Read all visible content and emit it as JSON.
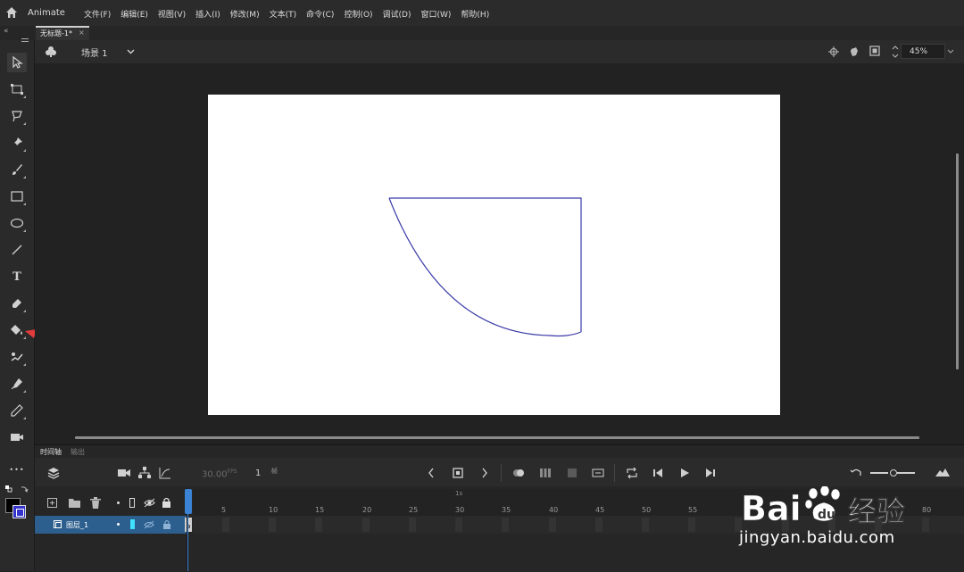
{
  "app": {
    "name": "Animate"
  },
  "menu": [
    "文件(F)",
    "编辑(E)",
    "视图(V)",
    "插入(I)",
    "修改(M)",
    "文本(T)",
    "命令(C)",
    "控制(O)",
    "调试(D)",
    "窗口(W)",
    "帮助(H)"
  ],
  "document_tab": {
    "title": "无标题-1*",
    "close": "×"
  },
  "scene_bar": {
    "scene": "场景 1",
    "zoom": "45%"
  },
  "tools": [
    {
      "name": "selection-tool-icon",
      "selected": true
    },
    {
      "name": "free-transform-tool-icon"
    },
    {
      "name": "lasso-tool-icon"
    },
    {
      "name": "pin-tool-icon"
    },
    {
      "name": "paint-brush-tool-icon"
    },
    {
      "name": "rectangle-tool-icon"
    },
    {
      "name": "oval-tool-icon"
    },
    {
      "name": "line-tool-icon"
    },
    {
      "name": "text-tool-icon",
      "glyph": "T"
    },
    {
      "name": "eraser-tool-icon"
    },
    {
      "name": "paint-bucket-tool-icon"
    },
    {
      "name": "bone-tool-icon"
    },
    {
      "name": "pen-tool-icon"
    },
    {
      "name": "eyedropper-tool-icon"
    },
    {
      "name": "camera-tool-icon"
    },
    {
      "name": "more-tools-icon",
      "glyph": "•••"
    }
  ],
  "colors": {
    "stroke": "#000000",
    "fill": "#3333cc",
    "shape_stroke": "#3a3aa8",
    "annotation_arrow": "#e23b3b",
    "playhead": "#3b83d4",
    "layer_highlight": "#2d5f8e"
  },
  "timeline": {
    "tabs": [
      "时间轴",
      "输出"
    ],
    "fps": "30.00",
    "fps_unit": "FPS",
    "current_frame": "1",
    "frame_unit": "帧",
    "ruler_numbers": [
      "5",
      "10",
      "15",
      "20",
      "25",
      "30",
      "35",
      "40",
      "45",
      "50",
      "55",
      "80"
    ],
    "ruler_markers": [
      "1s"
    ],
    "layer": {
      "name": "图层_1"
    }
  },
  "watermark": {
    "text": "Bai经验",
    "url": "jingyan.baidu.com"
  }
}
